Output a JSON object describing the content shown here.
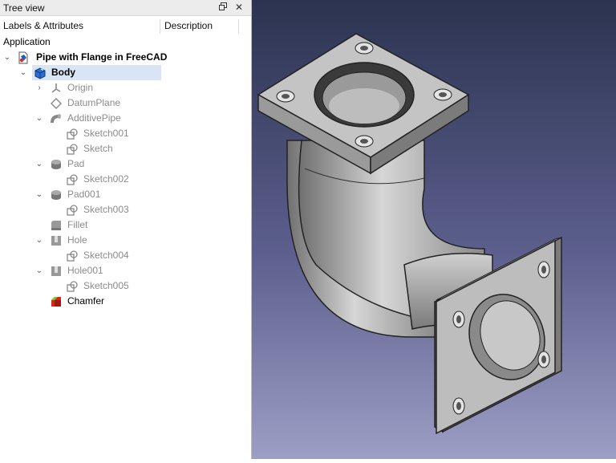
{
  "window": {
    "title": "Tree view",
    "float_icon": "float-icon",
    "close_icon": "close-icon"
  },
  "tree_header": {
    "labels_col": "Labels & Attributes",
    "description_col": "Description"
  },
  "tree": {
    "root": "Application",
    "items": [
      {
        "label": "Pipe with Flange in FreeCAD",
        "icon": "document-icon",
        "state": "expanded"
      },
      {
        "label": "Body",
        "icon": "body-icon",
        "state": "expanded",
        "selected": true
      },
      {
        "label": "Origin",
        "icon": "origin-icon",
        "state": "collapsed"
      },
      {
        "label": "DatumPlane",
        "icon": "datum-plane-icon"
      },
      {
        "label": "AdditivePipe",
        "icon": "additive-pipe-icon",
        "state": "expanded"
      },
      {
        "label": "Sketch001",
        "icon": "sketch-icon"
      },
      {
        "label": "Sketch",
        "icon": "sketch-icon"
      },
      {
        "label": "Pad",
        "icon": "pad-icon",
        "state": "expanded"
      },
      {
        "label": "Sketch002",
        "icon": "sketch-icon"
      },
      {
        "label": "Pad001",
        "icon": "pad-icon",
        "state": "expanded"
      },
      {
        "label": "Sketch003",
        "icon": "sketch-icon"
      },
      {
        "label": "Fillet",
        "icon": "fillet-icon"
      },
      {
        "label": "Hole",
        "icon": "hole-icon",
        "state": "expanded"
      },
      {
        "label": "Sketch004",
        "icon": "sketch-icon"
      },
      {
        "label": "Hole001",
        "icon": "hole-icon",
        "state": "expanded"
      },
      {
        "label": "Sketch005",
        "icon": "sketch-icon"
      },
      {
        "label": "Chamfer",
        "icon": "chamfer-icon"
      }
    ]
  },
  "viewport": {
    "content": "3d-model-pipe-with-flanges",
    "background_top": "#2c3350",
    "background_bottom": "#9d9ec5",
    "model_color": "#9a9a9a"
  },
  "colors": {
    "selection": "#d9e4f5",
    "dim_text": "#8c8c8c"
  }
}
